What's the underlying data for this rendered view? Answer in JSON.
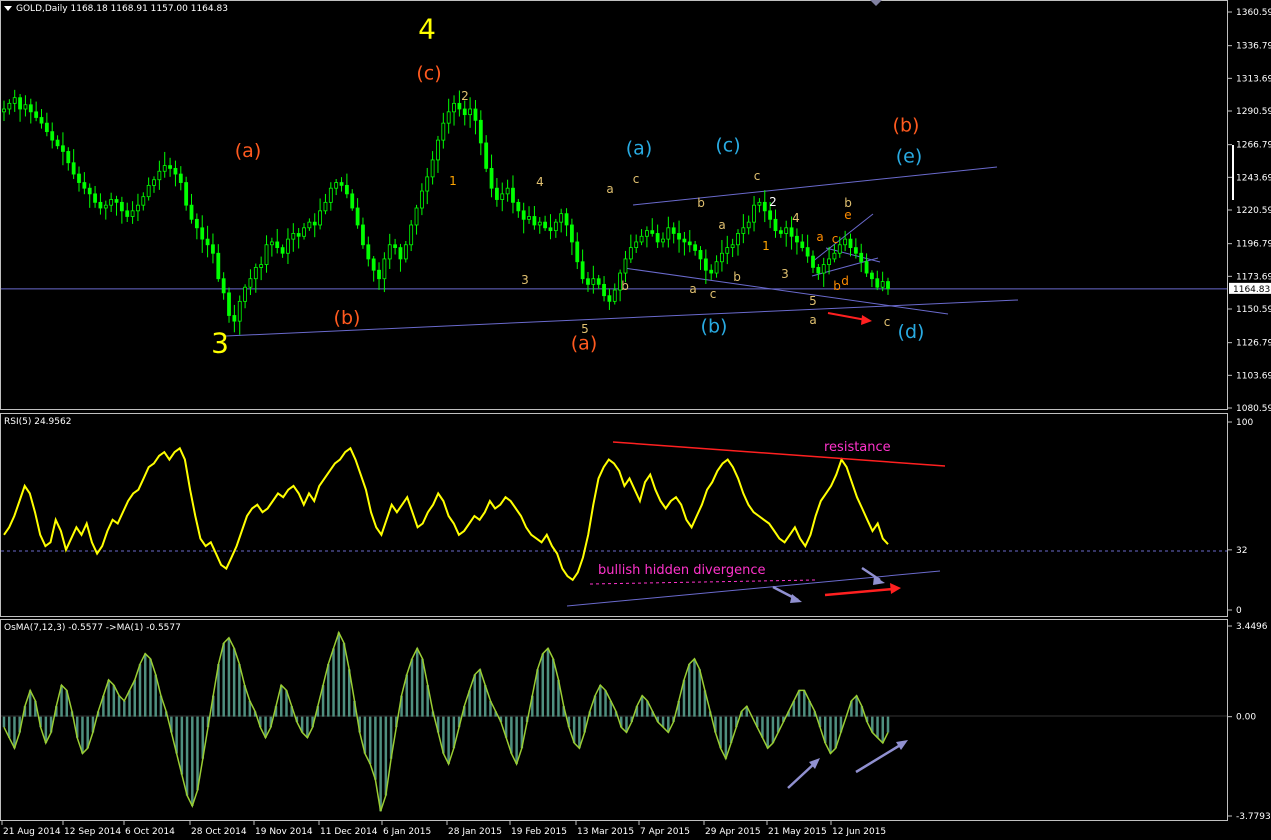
{
  "header": {
    "symbol_line": "GOLD,Daily  1168.18 1168.91 1157.00 1164.83"
  },
  "colors": {
    "background": "#000000",
    "frame": "#c0c0c0",
    "candle": "#00ff00",
    "rsi_line": "#ffff00",
    "osma_line": "#9acd32",
    "osma_hist": "#4f8f7f",
    "trendline": "#6a6acd",
    "red": "#ff2020",
    "orange_wave": "#ff5a1f",
    "cyan_wave": "#29abe2",
    "yellow_wave": "#ffff00",
    "minor_wave": "#e0c070",
    "magenta": "#ff33cc",
    "current_price_line": "#6a6acd"
  },
  "chart_data": [
    {
      "type": "candlestick",
      "name": "price-panel",
      "title": "GOLD,Daily",
      "ohlc_last": {
        "open": 1168.18,
        "high": 1168.91,
        "low": 1157.0,
        "close": 1164.83
      },
      "y_ticks": [
        "1360.59",
        "1336.79",
        "1313.69",
        "1290.59",
        "1266.79",
        "1243.69",
        "1220.59",
        "1196.79",
        "1173.69",
        "1150.59",
        "1126.79",
        "1103.69",
        "1080.59"
      ],
      "ylim": [
        1080.59,
        1360.59
      ],
      "current_price_label": "1164.83",
      "current_price": 1164.83,
      "x_ticks": [
        "21 Aug 2014",
        "12 Sep 2014",
        "6 Oct 2014",
        "28 Oct 2014",
        "19 Nov 2014",
        "11 Dec 2014",
        "6 Jan 2015",
        "28 Jan 2015",
        "19 Feb 2015",
        "13 Mar 2015",
        "7 Apr 2015",
        "29 Apr 2015",
        "21 May 2015",
        "12 Jun 2015"
      ],
      "closes": [
        1292,
        1296,
        1300,
        1292,
        1295,
        1290,
        1286,
        1282,
        1276,
        1270,
        1266,
        1262,
        1254,
        1246,
        1240,
        1236,
        1232,
        1226,
        1222,
        1224,
        1228,
        1226,
        1220,
        1216,
        1220,
        1224,
        1230,
        1238,
        1242,
        1248,
        1252,
        1250,
        1246,
        1240,
        1224,
        1214,
        1208,
        1200,
        1196,
        1190,
        1172,
        1162,
        1146,
        1142,
        1156,
        1166,
        1172,
        1180,
        1182,
        1196,
        1198,
        1194,
        1190,
        1200,
        1204,
        1202,
        1208,
        1212,
        1210,
        1220,
        1226,
        1236,
        1240,
        1238,
        1232,
        1222,
        1210,
        1196,
        1186,
        1178,
        1172,
        1186,
        1196,
        1194,
        1186,
        1196,
        1210,
        1222,
        1234,
        1244,
        1256,
        1270,
        1282,
        1290,
        1296,
        1292,
        1288,
        1292,
        1284,
        1268,
        1250,
        1236,
        1228,
        1232,
        1236,
        1226,
        1220,
        1214,
        1216,
        1210,
        1212,
        1208,
        1206,
        1212,
        1218,
        1210,
        1198,
        1184,
        1172,
        1168,
        1172,
        1168,
        1160,
        1156,
        1164,
        1176,
        1186,
        1194,
        1198,
        1202,
        1206,
        1204,
        1198,
        1200,
        1208,
        1204,
        1200,
        1198,
        1196,
        1192,
        1186,
        1178,
        1176,
        1184,
        1190,
        1194,
        1196,
        1204,
        1208,
        1212,
        1224,
        1226,
        1220,
        1214,
        1206,
        1204,
        1208,
        1202,
        1198,
        1194,
        1188,
        1180,
        1176,
        1182,
        1186,
        1190,
        1196,
        1200,
        1194,
        1190,
        1184,
        1176,
        1172,
        1166,
        1170,
        1165
      ],
      "wave_labels": [
        {
          "text": "4",
          "x_date": "6 Jan 2015",
          "price": 1342,
          "color": "#ffff00",
          "size": "large"
        },
        {
          "text": "3",
          "x_date": "28 Oct 2014",
          "price": 1120,
          "color": "#ffff00",
          "size": "large"
        },
        {
          "text": "(c)",
          "x_date": "6 Jan 2015",
          "price": 1313,
          "color": "#ff5a1f",
          "size": "medium"
        },
        {
          "text": "(a)",
          "x_date": "19 Nov 2014",
          "price": 1258,
          "color": "#ff5a1f",
          "size": "medium"
        },
        {
          "text": "(b)",
          "x_date": "11 Dec 2014",
          "price": 1140,
          "color": "#ff5a1f",
          "size": "medium"
        },
        {
          "text": "(a)",
          "x_date": "13 Mar 2015",
          "price": 1122,
          "color": "#ff5a1f",
          "size": "medium"
        },
        {
          "text": "(b)",
          "x_date": "12 Jun 2015",
          "price": 1276,
          "color": "#ff5a1f",
          "size": "medium"
        },
        {
          "text": "(a)",
          "x_date": "7 Apr 2015",
          "price": 1260,
          "color": "#29abe2",
          "size": "medium"
        },
        {
          "text": "(b)",
          "x_date": "29 Apr 2015",
          "price": 1134,
          "color": "#29abe2",
          "size": "medium"
        },
        {
          "text": "(c)",
          "x_date": "29 Apr 2015",
          "price": 1262,
          "color": "#29abe2",
          "size": "medium"
        },
        {
          "text": "(d)",
          "x_date": "12 Jun 2015",
          "price": 1130,
          "color": "#29abe2",
          "size": "medium"
        },
        {
          "text": "(e)",
          "x_date": "12 Jun 2015",
          "price": 1254,
          "color": "#29abe2",
          "size": "medium"
        }
      ],
      "minor_labels": [
        {
          "text": "2",
          "px": [
            465,
            100
          ],
          "color": "#e0c070"
        },
        {
          "text": "1",
          "px": [
            453,
            185
          ],
          "color": "#ffa500"
        },
        {
          "text": "4",
          "px": [
            540,
            186
          ],
          "color": "#e0c070"
        },
        {
          "text": "3",
          "px": [
            525,
            284
          ],
          "color": "#e0c070"
        },
        {
          "text": "5",
          "px": [
            585,
            333
          ],
          "color": "#e0c070"
        },
        {
          "text": "a",
          "px": [
            610,
            193
          ],
          "color": "#e0c070"
        },
        {
          "text": "c",
          "px": [
            636,
            183
          ],
          "color": "#e0c070"
        },
        {
          "text": "b",
          "px": [
            625,
            290
          ],
          "color": "#e0c070"
        },
        {
          "text": "b",
          "px": [
            701,
            207
          ],
          "color": "#e0c070"
        },
        {
          "text": "a",
          "px": [
            722,
            229
          ],
          "color": "#e0c070"
        },
        {
          "text": "a",
          "px": [
            693,
            293
          ],
          "color": "#e0c070"
        },
        {
          "text": "c",
          "px": [
            713,
            298
          ],
          "color": "#e0c070"
        },
        {
          "text": "b",
          "px": [
            737,
            281
          ],
          "color": "#e0c070"
        },
        {
          "text": "c",
          "px": [
            757,
            180
          ],
          "color": "#e0c070"
        },
        {
          "text": "2",
          "px": [
            773,
            206
          ],
          "color": "#ffffff"
        },
        {
          "text": "1",
          "px": [
            766,
            250
          ],
          "color": "#ffa500"
        },
        {
          "text": "4",
          "px": [
            796,
            222
          ],
          "color": "#e0c070"
        },
        {
          "text": "3",
          "px": [
            785,
            278
          ],
          "color": "#e0c070"
        },
        {
          "text": "5",
          "px": [
            813,
            305
          ],
          "color": "#e0c070"
        },
        {
          "text": "a",
          "px": [
            813,
            324
          ],
          "color": "#e0c070"
        },
        {
          "text": "b",
          "px": [
            848,
            207
          ],
          "color": "#e0c070"
        },
        {
          "text": "e",
          "px": [
            848,
            219
          ],
          "color": "#ff8c00"
        },
        {
          "text": "a",
          "px": [
            820,
            241
          ],
          "color": "#ff8c00"
        },
        {
          "text": "c",
          "px": [
            835,
            243
          ],
          "color": "#ff8c00"
        },
        {
          "text": "b",
          "px": [
            837,
            290
          ],
          "color": "#ff8c00"
        },
        {
          "text": "d",
          "px": [
            845,
            285
          ],
          "color": "#ff8c00"
        },
        {
          "text": "c",
          "px": [
            887,
            326
          ],
          "color": "#e0c070"
        }
      ]
    },
    {
      "type": "line",
      "name": "rsi-panel",
      "title": "RSI(5) 24.9562",
      "y_ticks": [
        "100",
        "32",
        "0"
      ],
      "ylim": [
        0,
        100
      ],
      "level": 32,
      "annotations": [
        "resistance",
        "bullish hidden divergence"
      ],
      "values": [
        40,
        44,
        50,
        58,
        66,
        62,
        52,
        40,
        34,
        36,
        48,
        42,
        32,
        38,
        44,
        40,
        46,
        36,
        30,
        34,
        42,
        48,
        46,
        52,
        58,
        62,
        64,
        70,
        76,
        78,
        82,
        84,
        80,
        84,
        86,
        80,
        64,
        50,
        38,
        34,
        36,
        30,
        24,
        22,
        28,
        34,
        42,
        50,
        54,
        56,
        52,
        54,
        58,
        62,
        60,
        64,
        66,
        62,
        56,
        62,
        58,
        66,
        70,
        74,
        78,
        80,
        84,
        86,
        80,
        72,
        64,
        52,
        44,
        40,
        48,
        56,
        52,
        56,
        60,
        52,
        44,
        46,
        52,
        56,
        62,
        58,
        50,
        46,
        40,
        42,
        46,
        50,
        48,
        52,
        58,
        54,
        56,
        60,
        58,
        54,
        50,
        44,
        40,
        38,
        36,
        40,
        34,
        30,
        22,
        18,
        16,
        20,
        28,
        40,
        56,
        70,
        76,
        80,
        78,
        74,
        66,
        70,
        64,
        58,
        68,
        72,
        64,
        58,
        54,
        58,
        60,
        56,
        48,
        44,
        50,
        56,
        64,
        68,
        74,
        78,
        80,
        76,
        70,
        62,
        56,
        52,
        50,
        48,
        46,
        42,
        38,
        36,
        40,
        44,
        38,
        34,
        40,
        50,
        58,
        62,
        66,
        72,
        80,
        76,
        68,
        60,
        54,
        48,
        42,
        46,
        38,
        35
      ],
      "arrow_labels": []
    },
    {
      "type": "bar",
      "name": "osma-panel",
      "title": "OsMA(7,12,3) -0.5577  ->MA(1) -0.5577",
      "y_ticks": [
        "3.4496",
        "0.00",
        "-3.7793"
      ],
      "ylim": [
        -3.7793,
        3.4496
      ],
      "values": [
        -0.4,
        -0.8,
        -1.2,
        -0.6,
        0.4,
        1.0,
        0.6,
        -0.4,
        -1.0,
        -0.6,
        0.4,
        1.2,
        1.0,
        0.2,
        -0.8,
        -1.4,
        -1.2,
        -0.6,
        0.2,
        0.8,
        1.4,
        1.2,
        0.8,
        0.6,
        1.0,
        1.4,
        2.0,
        2.4,
        2.2,
        1.6,
        0.8,
        0.2,
        -0.6,
        -1.4,
        -2.2,
        -3.0,
        -3.4,
        -2.8,
        -1.6,
        -0.4,
        0.8,
        2.0,
        2.8,
        3.0,
        2.6,
        2.0,
        1.2,
        0.6,
        0.2,
        -0.4,
        -0.8,
        -0.4,
        0.4,
        1.2,
        1.0,
        0.4,
        -0.2,
        -0.6,
        -0.8,
        -0.4,
        0.4,
        1.2,
        2.0,
        2.6,
        3.2,
        2.8,
        1.8,
        0.6,
        -0.6,
        -1.4,
        -1.8,
        -2.4,
        -3.6,
        -3.0,
        -1.6,
        -0.4,
        0.8,
        1.6,
        2.2,
        2.6,
        2.2,
        1.2,
        0.2,
        -0.6,
        -1.4,
        -1.8,
        -1.2,
        -0.4,
        0.4,
        1.0,
        1.6,
        1.8,
        1.2,
        0.6,
        0.2,
        -0.2,
        -0.8,
        -1.4,
        -1.8,
        -1.2,
        -0.2,
        0.8,
        1.8,
        2.4,
        2.6,
        2.2,
        1.4,
        0.4,
        -0.4,
        -1.0,
        -1.2,
        -0.6,
        0.2,
        0.8,
        1.2,
        1.0,
        0.6,
        0.2,
        -0.4,
        -0.6,
        -0.2,
        0.4,
        0.8,
        0.6,
        0.2,
        -0.2,
        -0.4,
        -0.6,
        -0.2,
        0.6,
        1.4,
        2.0,
        2.2,
        1.8,
        1.0,
        0.2,
        -0.6,
        -1.2,
        -1.6,
        -1.0,
        -0.4,
        0.2,
        0.4,
        0.0,
        -0.4,
        -0.8,
        -1.2,
        -1.0,
        -0.6,
        -0.2,
        0.2,
        0.6,
        1.0,
        1.0,
        0.6,
        0.2,
        -0.4,
        -1.0,
        -1.4,
        -1.2,
        -0.6,
        0.0,
        0.6,
        0.8,
        0.4,
        -0.2,
        -0.6,
        -0.8,
        -1.0,
        -0.6
      ]
    }
  ]
}
